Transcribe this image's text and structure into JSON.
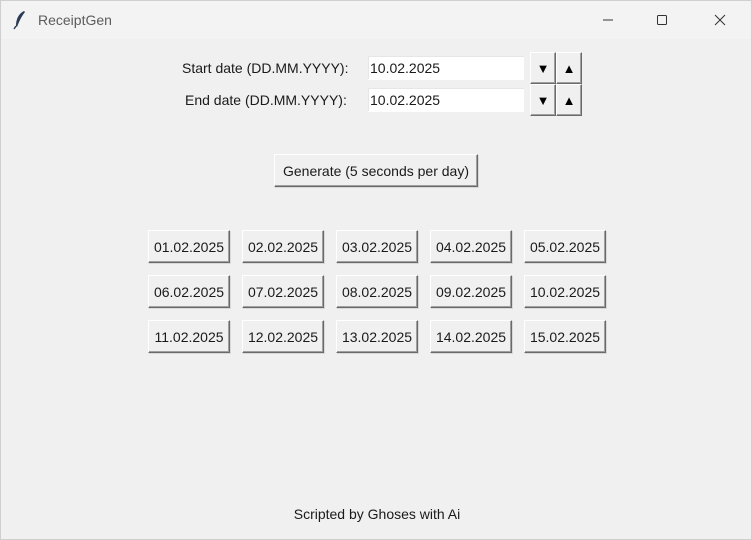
{
  "window": {
    "title": "ReceiptGen",
    "icons": {
      "app": "feather-icon",
      "minimize": "minimize-icon",
      "maximize": "maximize-icon",
      "close": "close-icon"
    }
  },
  "form": {
    "start_label": "Start date (DD.MM.YYYY):",
    "start_value": "10.02.2025",
    "end_label": "End date (DD.MM.YYYY):",
    "end_value": "10.02.2025",
    "down_glyph": "▼",
    "up_glyph": "▲"
  },
  "generate_label": "Generate (5 seconds per day)",
  "date_buttons": [
    "01.02.2025",
    "02.02.2025",
    "03.02.2025",
    "04.02.2025",
    "05.02.2025",
    "06.02.2025",
    "07.02.2025",
    "08.02.2025",
    "09.02.2025",
    "10.02.2025",
    "11.02.2025",
    "12.02.2025",
    "13.02.2025",
    "14.02.2025",
    "15.02.2025"
  ],
  "footer": "Scripted by Ghoses with Ai"
}
